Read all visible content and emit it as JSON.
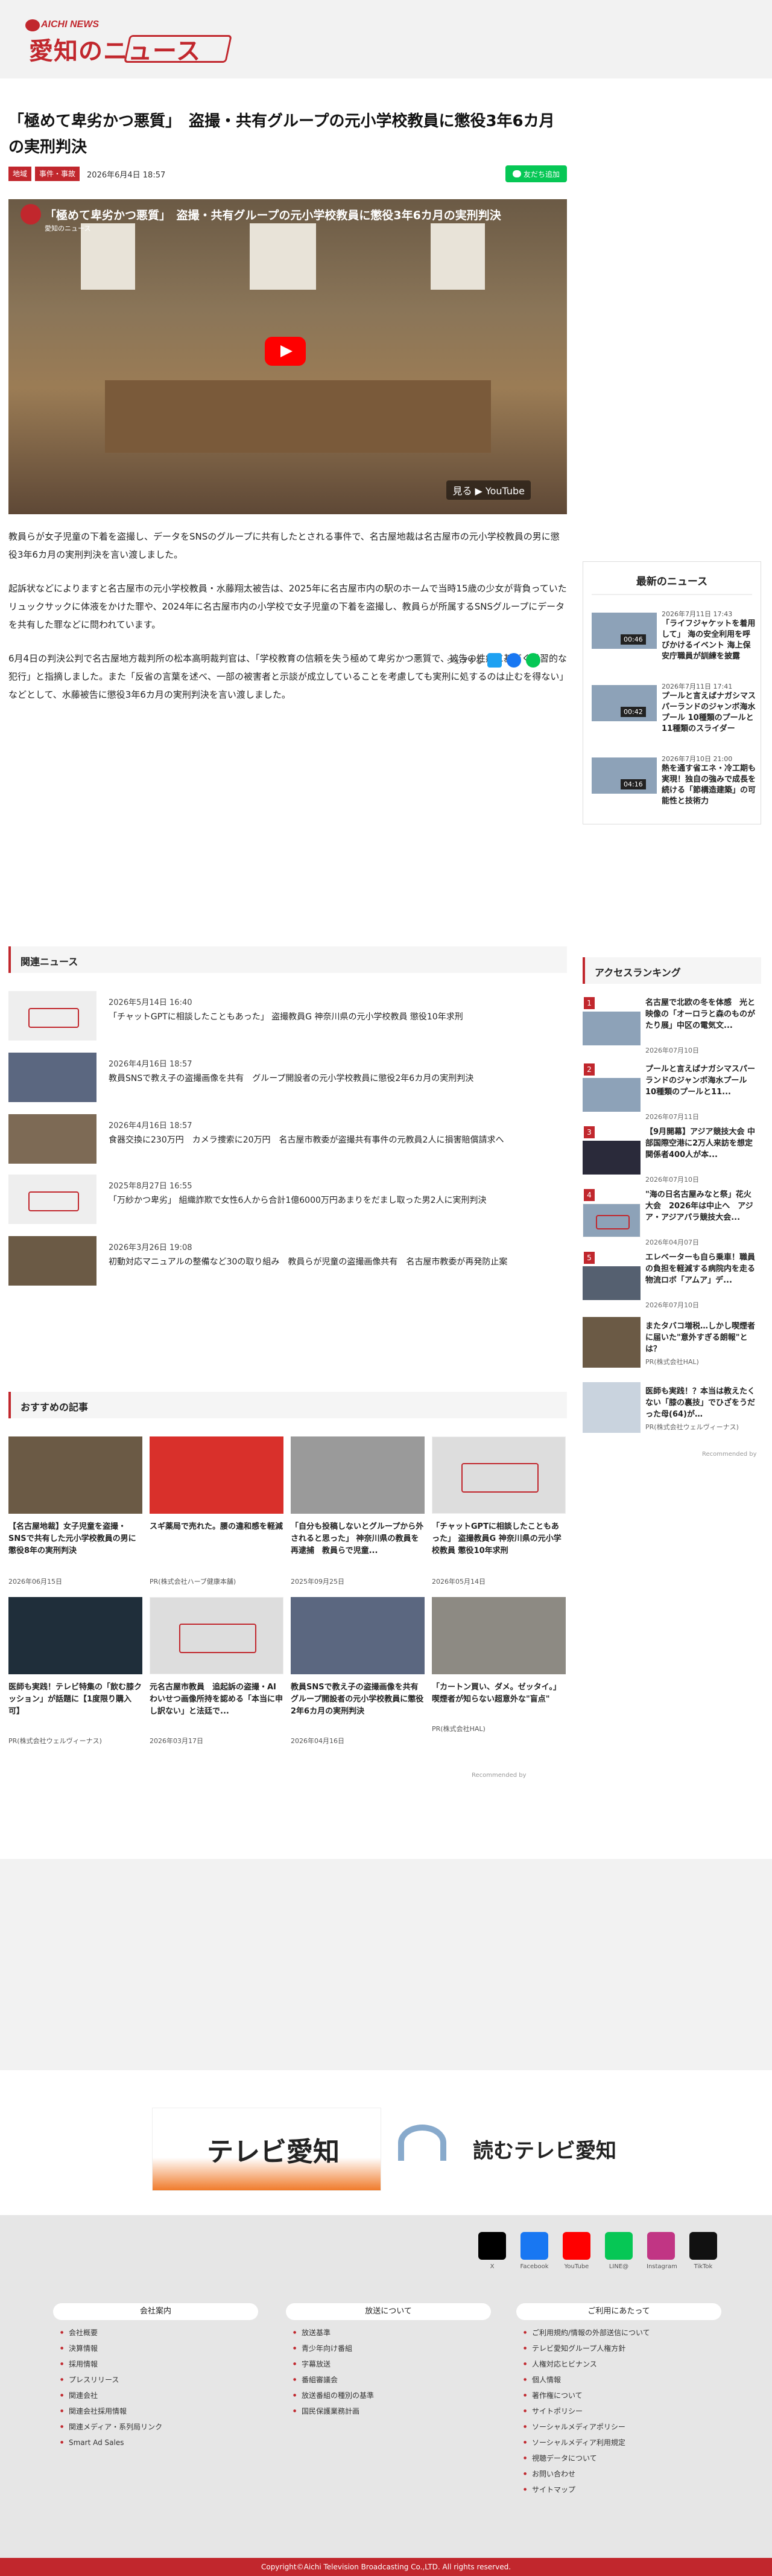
{
  "site": {
    "logo_en": "AICHI NEWS",
    "logo_jp": "愛知の",
    "logo_jp2": "ニュース"
  },
  "article": {
    "title": "「極めて卑劣かつ悪質」　盗撮・共有グループの元小学校教員に懲役3年6カ月の実刑判決",
    "tags": [
      "地域",
      "事件・事故"
    ],
    "date": "2026年6月4日 18:57",
    "friend_label": "友だち追加",
    "video_title": "「極めて卑劣かつ悪質」　盗撮・共有グループの元小学校教員に懲役3年6カ月の実刑判決",
    "video_channel": "愛知のニュース",
    "youtube_label": "見る ▶ YouTube",
    "p1": "教員らが女子児童の下着を盗撮し、データをSNSのグループに共有したとされる事件で、名古屋地裁は名古屋市の元小学校教員の男に懲役3年6カ月の実刑判決を言い渡しました。",
    "p2": "起訴状などによりますと名古屋市の元小学校教員・水藤翔太被告は、2025年に名古屋市内の駅のホームで当時15歳の少女が背負っていたリュックサックに体液をかけた罪や、2024年に名古屋市内の小学校で女子児童の下着を盗撮し、教員らが所属するSNSグループにデータを共有した罪などに問われています。",
    "p3": "6月4日の判決公判で名古屋地方裁判所の松本高明裁判官は、「学校教育の信頼を失う極めて卑劣かつ悪質で、被告の性癖に基づく常習的な犯行」と指摘しました。また「反省の言葉を述べ、一部の被害者と示談が成立していることを考慮しても実刑に処するのは止むを得ない」などとして、水藤被告に懲役3年6カ月の実刑判決を言い渡しました。",
    "share_label": "シェアする"
  },
  "latest": {
    "heading": "最新のニュース",
    "items": [
      {
        "date": "2026年7月11日 17:43",
        "dur": "00:46",
        "title": "「ライフジャケットを着用して」 海の安全利用を呼びかけるイベント 海上保安庁職員が訓練を披露"
      },
      {
        "date": "2026年7月11日 17:41",
        "dur": "00:42",
        "title": "プールと言えばナガシマスパーランドのジャンボ海水プール 10種類のプールと11種類のスライダー"
      },
      {
        "date": "2026年7月10日 21:00",
        "dur": "04:16",
        "title": "熱を通す省エネ・冷工期も実現！独自の強みで成長を続ける「節構造建築」の可能性と技術力"
      }
    ]
  },
  "related": {
    "heading": "関連ニュース",
    "items": [
      {
        "date": "2026年5月14日 16:40",
        "title": "「チャットGPTに相談したこともあった」 盗撮教員G 神奈川県の元小学校教員 懲役10年求刑"
      },
      {
        "date": "2026年4月16日 18:57",
        "title": "教員SNSで教え子の盗撮画像を共有　グループ開設者の元小学校教員に懲役2年6カ月の実刑判決"
      },
      {
        "date": "2026年4月16日 18:57",
        "title": "食器交換に230万円　カメラ捜索に20万円　名古屋市教委が盗撮共有事件の元教員2人に損害賠償請求へ"
      },
      {
        "date": "2025年8月27日 16:55",
        "title": "「万紗かつ卑劣」 組織詐欺で女性6人から合計1億6000万円あまりをだまし取った男2人に実刑判決"
      },
      {
        "date": "2026年3月26日 19:08",
        "title": "初動対応マニュアルの整備など30の取り組み　教員らが児童の盗撮画像共有　名古屋市教委が再発防止案"
      }
    ]
  },
  "ranking": {
    "heading": "アクセスランキング",
    "items": [
      {
        "num": "1",
        "title": "名古屋で北欧の冬を体感　光と映像の「オーロラと森のものがたり展」中区の電気文...",
        "date": "2026年07月10日"
      },
      {
        "num": "2",
        "title": "プールと言えばナガシマスパーランドのジャンボ海水プール　10種類のプールと11...",
        "date": "2026年07月11日"
      },
      {
        "num": "3",
        "title": "【9月開幕】アジア競技大会 中部国際空港に2万人来訪を想定　関係者400人が本...",
        "date": "2026年07月10日"
      },
      {
        "num": "4",
        "title": "\"海の日名古屋みなと祭」花火大会　2026年は中止へ　アジア・アジアパラ競技大会...",
        "date": "2026年04月07日"
      },
      {
        "num": "5",
        "title": "エレベーターも自ら乗車！職員の負担を軽減する病院内を走る物流ロボ「アムア」デ...",
        "date": "2026年07月10日"
      }
    ],
    "ads": [
      {
        "title": "またタバコ増税…しかし喫煙者に届いた\"意外すぎる朗報\"とは？",
        "source": "PR(株式会社HAL)"
      },
      {
        "title": "医師も実践！？本当は教えたくない「膝の裏技」でひざをうだった母(64)が…",
        "source": "PR(株式会社ウェルヴィーナス)"
      }
    ],
    "recommended": "Recommended by"
  },
  "recommend": {
    "heading": "おすすめの記事",
    "items": [
      {
        "title": "【名古屋地裁】女子児童を盗撮・SNSで共有した元小学校教員の男に懲役8年の実刑判決",
        "sub": "2026年06月15日"
      },
      {
        "title": "スギ薬局で売れた。腰の違和感を軽減",
        "sub": "PR(株式会社ハーブ健康本舗)"
      },
      {
        "title": "「自分も投稿しないとグループから外されると思った」 神奈川県の教員を再逮捕　教員らで児童...",
        "sub": "2025年09月25日"
      },
      {
        "title": "「チャットGPTに相談したこともあった」 盗撮教員G 神奈川県の元小学校教員 懲役10年求刑",
        "sub": "2026年05月14日"
      },
      {
        "title": "医師も実践！テレビ特集の「飲む膝クッション」が話題に【1度限り購入可】",
        "sub": "PR(株式会社ウェルヴィーナス)"
      },
      {
        "title": "元名古屋市教員　追起訴の盗撮・AIわいせつ画像所持を認める「本当に申し訳ない」と法廷で...",
        "sub": "2026年03月17日"
      },
      {
        "title": "教員SNSで教え子の盗撮画像を共有　グループ開設者の元小学校教員に懲役2年6カ月の実刑判決",
        "sub": "2026年04月16日"
      },
      {
        "title": "「カートン買い、ダメ。ゼッタイ。」喫煙者が知らない超意外な\"盲点\"",
        "sub": "PR(株式会社HAL)"
      }
    ],
    "recommended": "Recommended by"
  },
  "banners": {
    "tv": "テレビ愛知",
    "yomu": "読むテレビ愛知"
  },
  "social": [
    "X",
    "Facebook",
    "YouTube",
    "LINE@",
    "Instagram",
    "TikTok"
  ],
  "footer": {
    "c1": {
      "heading": "会社案内",
      "items": [
        "会社概要",
        "決算情報",
        "採用情報",
        "プレスリリース",
        "関連会社",
        "関連会社採用情報",
        "関連メディア・系列局リンク",
        "Smart Ad Sales"
      ]
    },
    "c2": {
      "heading": "放送について",
      "items": [
        "放送基準",
        "青少年向け番組",
        "字幕放送",
        "番組審議会",
        "放送番組の種別の基準",
        "国民保護業務計画"
      ]
    },
    "c3": {
      "heading": "ご利用にあたって",
      "items": [
        "ご利用規約/情報の外部送信について",
        "テレビ愛知グループ人権方針",
        "人権対応ヒビナンス",
        "個人情報",
        "著作権について",
        "サイトポリシー",
        "ソーシャルメディアポリシー",
        "ソーシャルメディア利用規定",
        "視聴データについて",
        "お問い合わせ",
        "サイトマップ"
      ]
    },
    "copyright": "Copyright©Aichi Television Broadcasting Co.,LTD. All rights reserved."
  },
  "colors": {
    "accent": "#c1272d",
    "line": "#06c755"
  }
}
